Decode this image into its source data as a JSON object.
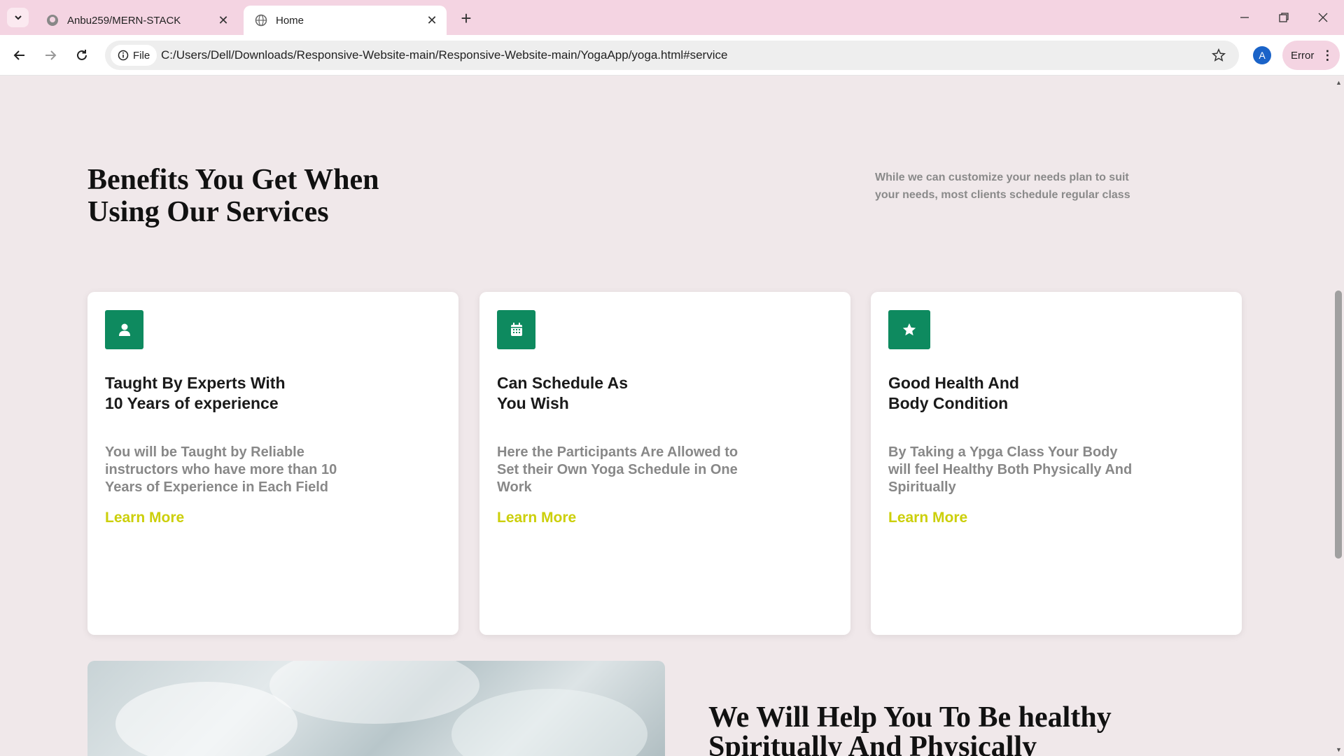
{
  "browser": {
    "tabs": [
      {
        "title": "Anbu259/MERN-STACK",
        "icon": "github-icon",
        "active": false
      },
      {
        "title": "Home",
        "icon": "globe-icon",
        "active": true
      }
    ],
    "security_chip": "File",
    "url": "C:/Users/Dell/Downloads/Responsive-Website-main/Responsive-Website-main/YogaApp/yoga.html#service",
    "profile_initial": "A",
    "error_label": "Error"
  },
  "section": {
    "title": "Benefits You Get When Using Our Services",
    "intro": "While we can customize your needs plan to suit your needs, most clients schedule regular class"
  },
  "cards": [
    {
      "icon": "user-icon",
      "title_line1": "Taught By Experts With",
      "title_line2": "10 Years of experience",
      "description": "You will be Taught by Reliable instructors who have more than 10 Years of Experience in Each Field",
      "link": "Learn More"
    },
    {
      "icon": "calendar-icon",
      "title_line1": "Can Schedule As",
      "title_line2": "You Wish",
      "description": "Here the Participants Are Allowed to Set their Own Yoga Schedule in One Work",
      "link": "Learn More"
    },
    {
      "icon": "star-icon",
      "title_line1": "Good Health And",
      "title_line2": "Body Condition",
      "description": "By Taking a Ypga Class Your Body will feel Healthy Both Physically And Spiritually",
      "link": "Learn More"
    }
  ],
  "next_section": {
    "title": "We Will Help You To Be healthy Spiritually And Physically"
  },
  "colors": {
    "accent_green": "#0e8a5f",
    "link_yellow": "#cccf0a",
    "page_bg": "#f0e8ea",
    "tabbar_bg": "#f4d4e2"
  }
}
